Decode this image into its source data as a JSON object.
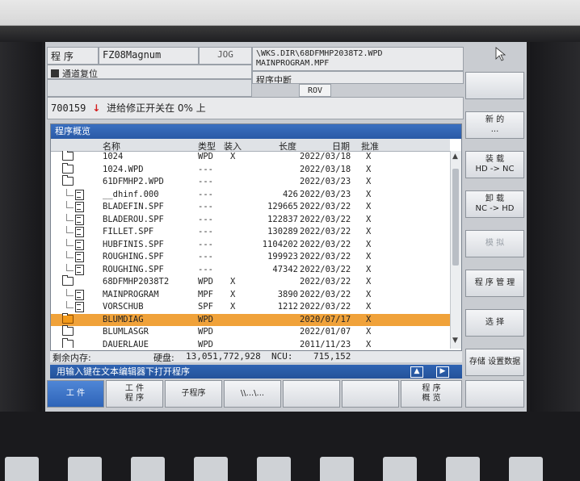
{
  "header": {
    "mode_label": "程 序",
    "machine_name": "FZ08Magnum",
    "jog": "JOG",
    "path_line1": "\\WKS.DIR\\68DFMHP2038T2.WPD",
    "path_line2": "MAINPROGRAM.MPF",
    "reset_status": "通道复位",
    "program_status": "程序中断",
    "rov": "ROV",
    "alarm_number": "700159",
    "alarm_text": "进给修正开关在 0% 上"
  },
  "overview": {
    "title": "程序概览",
    "columns": {
      "name": "名称",
      "type": "类型",
      "loaded": "装入",
      "length": "长度",
      "date": "日期",
      "enable": "批准"
    },
    "rows": [
      {
        "icon": "folder",
        "indent": 0,
        "name": "1024",
        "type": "WPD",
        "loaded": "X",
        "length": "",
        "date": "2022/03/18",
        "enable": "X"
      },
      {
        "icon": "folder",
        "indent": 0,
        "name": "1024.WPD",
        "type": "---",
        "loaded": "",
        "length": "",
        "date": "2022/03/18",
        "enable": "X"
      },
      {
        "icon": "folder-open",
        "indent": 0,
        "name": "61DFMHP2.WPD",
        "type": "---",
        "loaded": "",
        "length": "",
        "date": "2022/03/23",
        "enable": "X"
      },
      {
        "icon": "file",
        "indent": 1,
        "name": "__dhinf.000",
        "type": "---",
        "loaded": "",
        "length": "426",
        "date": "2022/03/23",
        "enable": "X"
      },
      {
        "icon": "file",
        "indent": 1,
        "name": "BLADEFIN.SPF",
        "type": "---",
        "loaded": "",
        "length": "129665",
        "date": "2022/03/22",
        "enable": "X"
      },
      {
        "icon": "file",
        "indent": 1,
        "name": "BLADEROU.SPF",
        "type": "---",
        "loaded": "",
        "length": "122837",
        "date": "2022/03/22",
        "enable": "X"
      },
      {
        "icon": "file",
        "indent": 1,
        "name": "FILLET.SPF",
        "type": "---",
        "loaded": "",
        "length": "130289",
        "date": "2022/03/22",
        "enable": "X"
      },
      {
        "icon": "file",
        "indent": 1,
        "name": "HUBFINIS.SPF",
        "type": "---",
        "loaded": "",
        "length": "1104202",
        "date": "2022/03/22",
        "enable": "X"
      },
      {
        "icon": "file",
        "indent": 1,
        "name": "ROUGHING.SPF",
        "type": "---",
        "loaded": "",
        "length": "199923",
        "date": "2022/03/22",
        "enable": "X"
      },
      {
        "icon": "file",
        "indent": 1,
        "name": "ROUGHING.SPF",
        "type": "---",
        "loaded": "",
        "length": "47342",
        "date": "2022/03/22",
        "enable": "X"
      },
      {
        "icon": "folder-open",
        "indent": 0,
        "name": "68DFMHP2038T2",
        "type": "WPD",
        "loaded": "X",
        "length": "",
        "date": "2022/03/22",
        "enable": "X"
      },
      {
        "icon": "file",
        "indent": 1,
        "name": "MAINPROGRAM",
        "type": "MPF",
        "loaded": "X",
        "length": "3890",
        "date": "2022/03/22",
        "enable": "X"
      },
      {
        "icon": "file",
        "indent": 1,
        "name": "VORSCHUB",
        "type": "SPF",
        "loaded": "X",
        "length": "1212",
        "date": "2022/03/22",
        "enable": "X"
      },
      {
        "icon": "folder-filled",
        "indent": 0,
        "name": "BLUMDIAG",
        "type": "WPD",
        "loaded": "",
        "length": "",
        "date": "2020/07/17",
        "enable": "X",
        "selected": true
      },
      {
        "icon": "folder",
        "indent": 0,
        "name": "BLUMLASGR",
        "type": "WPD",
        "loaded": "",
        "length": "",
        "date": "2022/01/07",
        "enable": "X"
      },
      {
        "icon": "folder",
        "indent": 0,
        "name": "DAUERLAUE",
        "type": "WPD",
        "loaded": "",
        "length": "",
        "date": "2011/11/23",
        "enable": "X"
      }
    ],
    "memory_label": "剩余内存:",
    "disk_label": "硬盘:",
    "disk_value": "13,051,772,928",
    "ncu_label": "NCU:",
    "ncu_value": "715,152"
  },
  "hint": "用输入键在文本编辑器下打开程序",
  "softkeys_right": [
    "",
    "新 的\n...",
    "装 载\nHD -> NC",
    "卸 载\nNC -> HD",
    "模 拟",
    "程 序 管 理",
    "选 择",
    "存储 设置数据"
  ],
  "softkeys_bottom": [
    "工 件",
    "工 件\n程 序",
    "子程序",
    "\\\\...\\...",
    "",
    "",
    "程 序\n概 览",
    ""
  ],
  "colors": {
    "title_bar": "#2a5aa6",
    "selected_row": "#f0a23a",
    "active_tab": "#2e64b8",
    "alarm_arrow": "#d41c1c"
  }
}
